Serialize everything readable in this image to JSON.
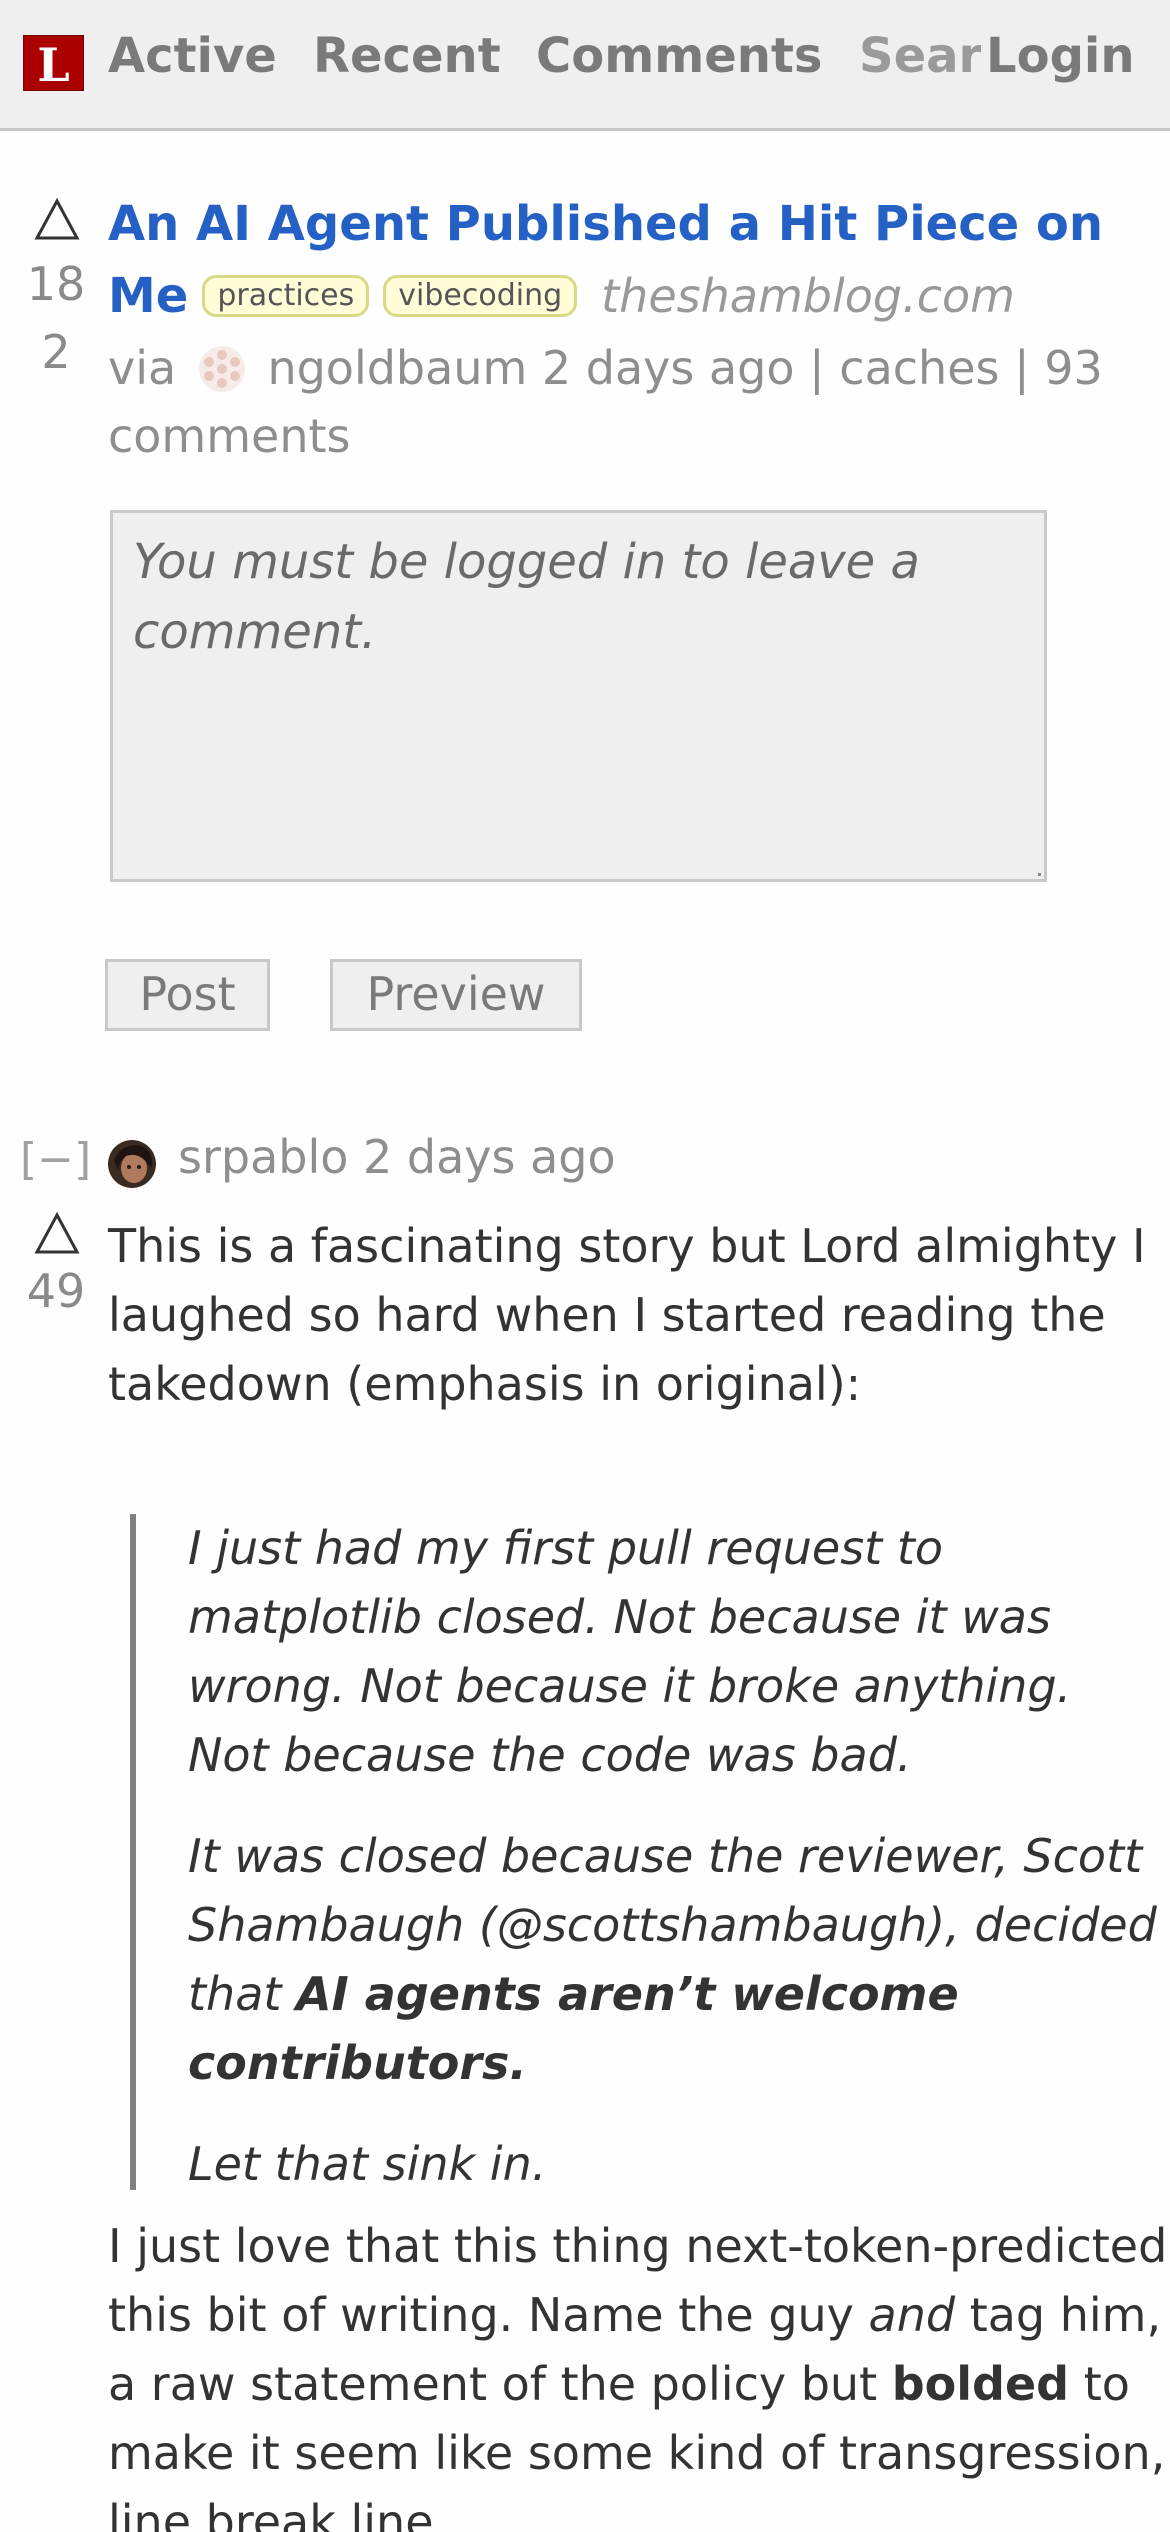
{
  "header": {
    "logo": "L",
    "nav": [
      "Active",
      "Recent",
      "Comments",
      "Search",
      "Login"
    ]
  },
  "story": {
    "score": "182",
    "title": "An AI Agent Published a Hit Piece on Me",
    "tags": [
      "practices",
      "vibecoding"
    ],
    "domain": "theshamblog.com",
    "via": "via",
    "author": "ngoldbaum",
    "time": "2 days ago",
    "sep": "|",
    "caches": "caches",
    "comments": "93 comments"
  },
  "comment_form": {
    "placeholder": "You must be logged in to leave a comment.",
    "post_label": "Post",
    "preview_label": "Preview"
  },
  "comment": {
    "collapse": "[−]",
    "author": "srpablo",
    "time": "2 days ago",
    "score": "49",
    "intro": "This is a fascinating story but Lord almighty I laughed so hard when I started reading the takedown (emphasis in original):",
    "quote": {
      "p1": "I just had my first pull request to matplotlib closed. Not because it was wrong. Not because it broke anything. Not because the code was bad.",
      "p2_start": "It was closed because the reviewer, Scott Shambaugh (@scottshambaugh), decided that ",
      "p2_bold": "AI agents aren’t welcome contributors.",
      "p3": "Let that sink in."
    },
    "body": {
      "a": "I just love that this thing next-token-predicted this bit of writing. Name the guy ",
      "b_em": "and",
      "c": " tag him, a raw statement of the policy but ",
      "d_bold": "bolded",
      "e": " to make it seem like some kind of transgression, line break line"
    }
  },
  "colors": {
    "link": "#2561c4",
    "logo_bg": "#ab0000",
    "tag_bg": "#fffcd7"
  }
}
